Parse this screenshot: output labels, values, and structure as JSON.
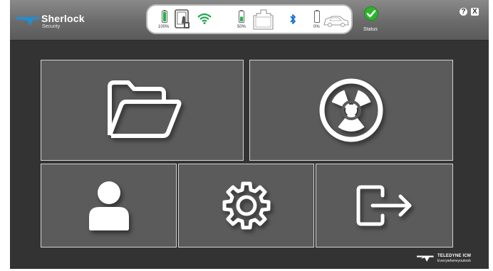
{
  "app": {
    "name": "Sherlock",
    "subtitle": "Security"
  },
  "status_panel": {
    "devices": [
      {
        "icon": "tablet-icon",
        "battery_label": "100%",
        "battery_level": 1.0
      },
      {
        "icon": "wifi-icon"
      },
      {
        "icon": "scanner-icon",
        "battery_label": "50%",
        "battery_level": 0.5
      },
      {
        "icon": "bluetooth-icon"
      },
      {
        "icon": "vehicle-icon",
        "battery_label": "0%",
        "battery_level": 0.0
      }
    ]
  },
  "status": {
    "label": "Status",
    "icon": "check-icon",
    "color": "#2db52d"
  },
  "window_controls": {
    "help": "?",
    "close": "X"
  },
  "tiles": [
    {
      "icon": "folder-icon"
    },
    {
      "icon": "radiation-icon"
    },
    {
      "icon": "user-icon"
    },
    {
      "icon": "gear-icon"
    },
    {
      "icon": "logout-icon"
    }
  ],
  "footer": {
    "company": "TELEDYNE ICM",
    "tagline": "Everywhereyoulook"
  },
  "colors": {
    "screen_bg": "#333333",
    "tile_bg": "#5b5b5b",
    "tile_border": "#d2d2d2",
    "brand_blue": "#1f8fd6",
    "wifi_green": "#1ea84a",
    "bluetooth_blue": "#1a6fd6",
    "status_green": "#2db52d"
  }
}
